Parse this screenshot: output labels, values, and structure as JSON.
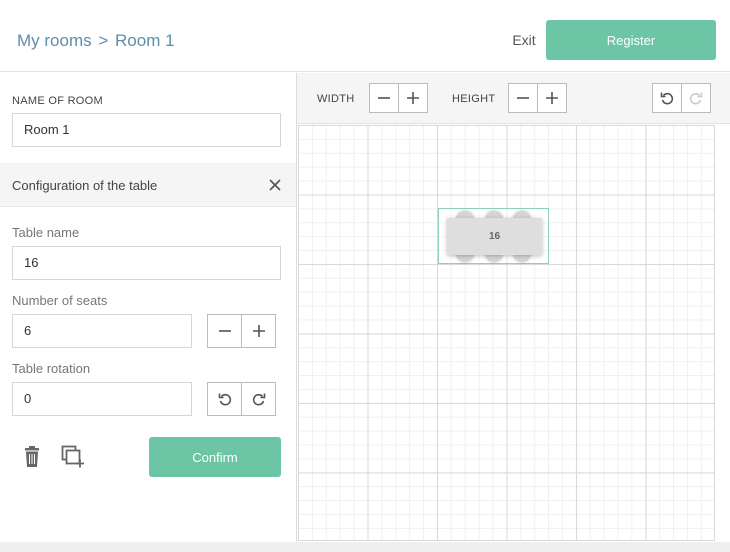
{
  "header": {
    "breadcrumb_root": "My rooms",
    "breadcrumb_sep": ">",
    "breadcrumb_current": "Room 1",
    "exit_label": "Exit",
    "register_label": "Register"
  },
  "sidebar": {
    "room_name_label": "NAME OF ROOM",
    "room_name_value": "Room 1",
    "config_title": "Configuration of the table",
    "table_name_label": "Table name",
    "table_name_value": "16",
    "seats_label": "Number of seats",
    "seats_value": "6",
    "rotation_label": "Table rotation",
    "rotation_value": "0",
    "confirm_label": "Confirm"
  },
  "toolbar": {
    "width_label": "WIDTH",
    "height_label": "HEIGHT"
  },
  "canvas": {
    "table_label": "16"
  },
  "icons": {
    "close": "close-icon",
    "minus": "minus-icon",
    "plus": "plus-icon",
    "rotate_left": "rotate-left-icon",
    "rotate_right": "rotate-right-icon",
    "undo": "undo-icon",
    "redo": "redo-icon",
    "trash": "trash-icon",
    "duplicate": "duplicate-icon"
  },
  "colors": {
    "accent": "#6cc5a4",
    "link": "#5c8fa8"
  }
}
